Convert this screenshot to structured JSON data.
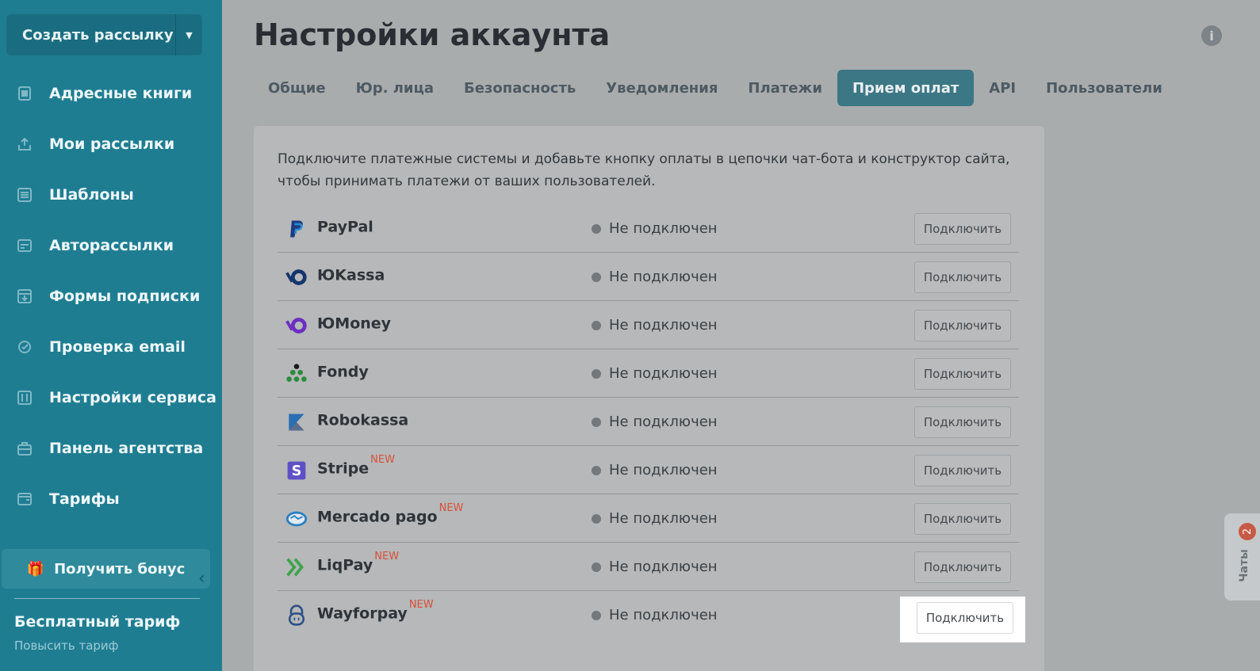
{
  "sidebar": {
    "create_label": "Создать рассылку",
    "items": [
      {
        "label": "Адресные книги",
        "icon": "address-book-icon"
      },
      {
        "label": "Мои рассылки",
        "icon": "mailing-icon"
      },
      {
        "label": "Шаблоны",
        "icon": "templates-icon"
      },
      {
        "label": "Авторассылки",
        "icon": "auto-mailing-icon"
      },
      {
        "label": "Формы подписки",
        "icon": "subscription-form-icon"
      },
      {
        "label": "Проверка email",
        "icon": "email-check-icon"
      },
      {
        "label": "Настройки сервиса",
        "icon": "service-settings-icon"
      },
      {
        "label": "Панель агентства",
        "icon": "agency-panel-icon"
      },
      {
        "label": "Тарифы",
        "icon": "tariffs-icon"
      }
    ],
    "bonus_label": "Получить бонус",
    "plan_name": "Бесплатный тариф",
    "plan_upgrade": "Повысить тариф"
  },
  "header": {
    "title": "Настройки аккаунта"
  },
  "tabs": [
    {
      "label": "Общие"
    },
    {
      "label": "Юр. лица"
    },
    {
      "label": "Безопасность"
    },
    {
      "label": "Уведомления"
    },
    {
      "label": "Платежи"
    },
    {
      "label": "Прием оплат",
      "active": true
    },
    {
      "label": "API"
    },
    {
      "label": "Пользователи"
    }
  ],
  "content": {
    "intro": "Подключите платежные системы и добавьте кнопку оплаты в цепочки чат-бота и конструктор сайта, чтобы принимать платежи от ваших пользователей.",
    "providers": [
      {
        "name": "PayPal",
        "new": "",
        "status": "Не подключен",
        "button": "Подключить",
        "icon": "paypal-icon"
      },
      {
        "name": "ЮKassa",
        "new": "",
        "status": "Не подключен",
        "button": "Подключить",
        "icon": "yukassa-icon"
      },
      {
        "name": "ЮMoney",
        "new": "",
        "status": "Не подключен",
        "button": "Подключить",
        "icon": "yumoney-icon"
      },
      {
        "name": "Fondy",
        "new": "",
        "status": "Не подключен",
        "button": "Подключить",
        "icon": "fondy-icon"
      },
      {
        "name": "Robokassa",
        "new": "",
        "status": "Не подключен",
        "button": "Подключить",
        "icon": "robokassa-icon"
      },
      {
        "name": "Stripe",
        "new": "NEW",
        "status": "Не подключен",
        "button": "Подключить",
        "icon": "stripe-icon"
      },
      {
        "name": "Mercado pago",
        "new": "NEW",
        "status": "Не подключен",
        "button": "Подключить",
        "icon": "mercado-pago-icon"
      },
      {
        "name": "LiqPay",
        "new": "NEW",
        "status": "Не подключен",
        "button": "Подключить",
        "icon": "liqpay-icon"
      },
      {
        "name": "Wayforpay",
        "new": "NEW",
        "status": "Не подключен",
        "button": "Подключить",
        "icon": "wayforpay-icon"
      }
    ]
  },
  "chats": {
    "label": "Чаты",
    "badge": "2"
  },
  "colors": {
    "sidebar": "#1f7d92",
    "active_tab": "#3c7785",
    "new_badge": "#d9503a"
  }
}
